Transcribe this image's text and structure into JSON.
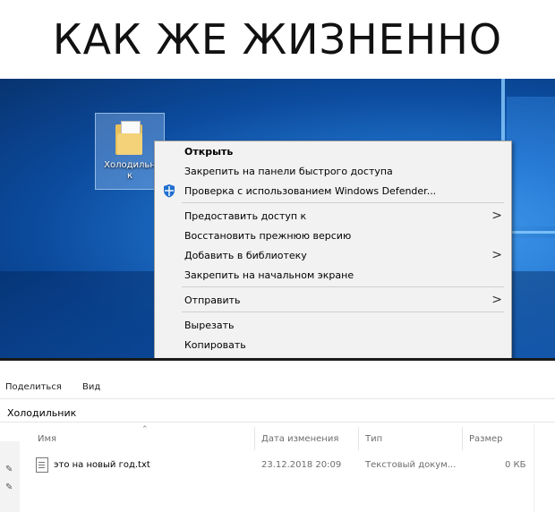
{
  "meme_caption": "КАК ЖЕ ЖИЗНЕННО",
  "desktop": {
    "folder_label": "Холодильн\nк"
  },
  "context_menu": {
    "items": [
      {
        "label": "Открыть",
        "bold": true
      },
      {
        "label": "Закрепить на панели быстрого доступа"
      },
      {
        "label": "Проверка с использованием Windows Defender...",
        "icon": "windows-defender-shield-icon"
      },
      {
        "label": "Предоставить доступ к",
        "submenu": true
      },
      {
        "label": "Восстановить прежнюю версию"
      },
      {
        "label": "Добавить в библиотеку",
        "submenu": true
      },
      {
        "label": "Закрепить на начальном экране"
      },
      {
        "label": "Отправить",
        "submenu": true
      },
      {
        "label": "Вырезать"
      },
      {
        "label": "Копировать"
      }
    ],
    "arrow_glyph": ">"
  },
  "explorer": {
    "ribbon_tabs": [
      "Поделиться",
      "Вид"
    ],
    "folder_path": "Холодильник",
    "columns": {
      "name": "Имя",
      "modified": "Дата изменения",
      "type": "Тип",
      "size": "Размер"
    },
    "files": [
      {
        "name": "это на новый год.txt",
        "modified": "23.12.2018 20:09",
        "type": "Текстовый докум...",
        "size": "0 КБ"
      }
    ]
  },
  "colors": {
    "desktop_blue": "#0b4a9c",
    "menu_background": "#f2f2f2",
    "folder_yellow": "#e8c15b"
  }
}
